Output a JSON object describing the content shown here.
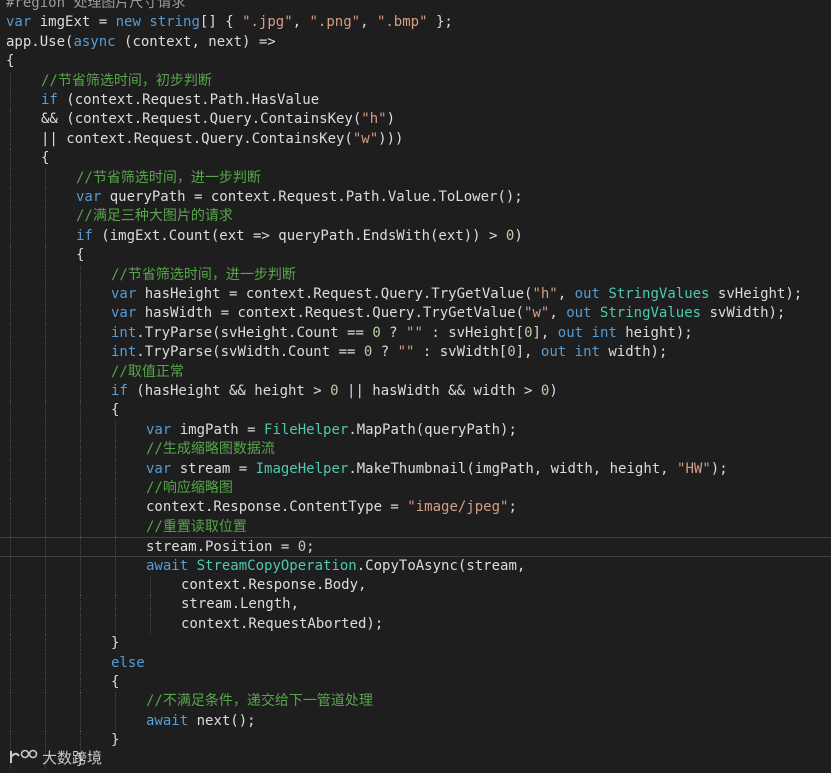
{
  "colors": {
    "background": "#1e1e1e",
    "text": "#dcdcdc",
    "keyword": "#569cd6",
    "comment": "#57a64a",
    "string": "#d69d85",
    "type": "#4ec9b0",
    "number": "#b5cea8",
    "region": "#9b9b9b"
  },
  "watermark": {
    "text": "大数跨境",
    "icon": "logo-icon"
  },
  "current_line": 28,
  "lines": [
    {
      "indent": 0,
      "tokens": [
        [
          "#region ",
          "region"
        ],
        [
          "处理图片尺寸请求",
          "region"
        ]
      ]
    },
    {
      "indent": 0,
      "tokens": [
        [
          "var",
          "keyword"
        ],
        [
          " imgExt = ",
          "text"
        ],
        [
          "new",
          "keyword"
        ],
        [
          " ",
          "text"
        ],
        [
          "string",
          "keyword"
        ],
        [
          "[] { ",
          "text"
        ],
        [
          "\".jpg\"",
          "string"
        ],
        [
          ", ",
          "text"
        ],
        [
          "\".png\"",
          "string"
        ],
        [
          ", ",
          "text"
        ],
        [
          "\".bmp\"",
          "string"
        ],
        [
          " };",
          "text"
        ]
      ]
    },
    {
      "indent": 0,
      "tokens": [
        [
          "app.Use(",
          "text"
        ],
        [
          "async",
          "keyword"
        ],
        [
          " (context, next) =>",
          "text"
        ]
      ]
    },
    {
      "indent": 0,
      "tokens": [
        [
          "{",
          "text"
        ]
      ]
    },
    {
      "indent": 1,
      "tokens": [
        [
          "//节省筛选时间，初步判断",
          "comment"
        ]
      ]
    },
    {
      "indent": 1,
      "tokens": [
        [
          "if",
          "keyword"
        ],
        [
          " (context.Request.Path.HasValue",
          "text"
        ]
      ]
    },
    {
      "indent": 1,
      "tokens": [
        [
          "&& (context.Request.Query.ContainsKey(",
          "text"
        ],
        [
          "\"h\"",
          "string"
        ],
        [
          ")",
          "text"
        ]
      ]
    },
    {
      "indent": 1,
      "tokens": [
        [
          "|| context.Request.Query.ContainsKey(",
          "text"
        ],
        [
          "\"w\"",
          "string"
        ],
        [
          ")))",
          "text"
        ]
      ]
    },
    {
      "indent": 1,
      "tokens": [
        [
          "{",
          "text"
        ]
      ]
    },
    {
      "indent": 2,
      "tokens": [
        [
          "//节省筛选时间，进一步判断",
          "comment"
        ]
      ]
    },
    {
      "indent": 2,
      "tokens": [
        [
          "var",
          "keyword"
        ],
        [
          " queryPath = context.Request.Path.Value.ToLower();",
          "text"
        ]
      ]
    },
    {
      "indent": 2,
      "tokens": [
        [
          "//满足三种大图片的请求",
          "comment"
        ]
      ]
    },
    {
      "indent": 2,
      "tokens": [
        [
          "if",
          "keyword"
        ],
        [
          " (imgExt.Count(ext => queryPath.EndsWith(ext)) > ",
          "text"
        ],
        [
          "0",
          "number"
        ],
        [
          ")",
          "text"
        ]
      ]
    },
    {
      "indent": 2,
      "tokens": [
        [
          "{",
          "text"
        ]
      ]
    },
    {
      "indent": 3,
      "tokens": [
        [
          "//节省筛选时间，进一步判断",
          "comment"
        ]
      ]
    },
    {
      "indent": 3,
      "tokens": [
        [
          "var",
          "keyword"
        ],
        [
          " hasHeight = context.Request.Query.TryGetValue(",
          "text"
        ],
        [
          "\"h\"",
          "string"
        ],
        [
          ", ",
          "text"
        ],
        [
          "out",
          "keyword"
        ],
        [
          " ",
          "text"
        ],
        [
          "StringValues",
          "type"
        ],
        [
          " svHeight);",
          "text"
        ]
      ]
    },
    {
      "indent": 3,
      "tokens": [
        [
          "var",
          "keyword"
        ],
        [
          " hasWidth = context.Request.Query.TryGetValue(",
          "text"
        ],
        [
          "\"w\"",
          "string"
        ],
        [
          ", ",
          "text"
        ],
        [
          "out",
          "keyword"
        ],
        [
          " ",
          "text"
        ],
        [
          "StringValues",
          "type"
        ],
        [
          " svWidth);",
          "text"
        ]
      ]
    },
    {
      "indent": 3,
      "tokens": [
        [
          "int",
          "keyword"
        ],
        [
          ".TryParse(svHeight.Count == ",
          "text"
        ],
        [
          "0",
          "number"
        ],
        [
          " ? ",
          "text"
        ],
        [
          "\"\"",
          "string"
        ],
        [
          " : svHeight[",
          "text"
        ],
        [
          "0",
          "number"
        ],
        [
          "], ",
          "text"
        ],
        [
          "out",
          "keyword"
        ],
        [
          " ",
          "text"
        ],
        [
          "int",
          "keyword"
        ],
        [
          " height);",
          "text"
        ]
      ]
    },
    {
      "indent": 3,
      "tokens": [
        [
          "int",
          "keyword"
        ],
        [
          ".TryParse(svWidth.Count == ",
          "text"
        ],
        [
          "0",
          "number"
        ],
        [
          " ? ",
          "text"
        ],
        [
          "\"\"",
          "string"
        ],
        [
          " : svWidth[",
          "text"
        ],
        [
          "0",
          "number"
        ],
        [
          "], ",
          "text"
        ],
        [
          "out",
          "keyword"
        ],
        [
          " ",
          "text"
        ],
        [
          "int",
          "keyword"
        ],
        [
          " width);",
          "text"
        ]
      ]
    },
    {
      "indent": 3,
      "tokens": [
        [
          "//取值正常",
          "comment"
        ]
      ]
    },
    {
      "indent": 3,
      "tokens": [
        [
          "if",
          "keyword"
        ],
        [
          " (hasHeight && height > ",
          "text"
        ],
        [
          "0",
          "number"
        ],
        [
          " || hasWidth && width > ",
          "text"
        ],
        [
          "0",
          "number"
        ],
        [
          ")",
          "text"
        ]
      ]
    },
    {
      "indent": 3,
      "tokens": [
        [
          "{",
          "text"
        ]
      ]
    },
    {
      "indent": 4,
      "tokens": [
        [
          "var",
          "keyword"
        ],
        [
          " imgPath = ",
          "text"
        ],
        [
          "FileHelper",
          "type"
        ],
        [
          ".MapPath(queryPath);",
          "text"
        ]
      ]
    },
    {
      "indent": 4,
      "tokens": [
        [
          "//生成缩略图数据流",
          "comment"
        ]
      ]
    },
    {
      "indent": 4,
      "tokens": [
        [
          "var",
          "keyword"
        ],
        [
          " stream = ",
          "text"
        ],
        [
          "ImageHelper",
          "type"
        ],
        [
          ".MakeThumbnail(imgPath, width, height, ",
          "text"
        ],
        [
          "\"HW\"",
          "string"
        ],
        [
          ");",
          "text"
        ]
      ]
    },
    {
      "indent": 4,
      "tokens": [
        [
          "//响应缩略图",
          "comment"
        ]
      ]
    },
    {
      "indent": 4,
      "tokens": [
        [
          "context.Response.ContentType = ",
          "text"
        ],
        [
          "\"image/jpeg\"",
          "string"
        ],
        [
          ";",
          "text"
        ]
      ]
    },
    {
      "indent": 4,
      "tokens": [
        [
          "//重置读取位置",
          "comment"
        ]
      ]
    },
    {
      "indent": 4,
      "tokens": [
        [
          "stream.Position = ",
          "text"
        ],
        [
          "0",
          "number"
        ],
        [
          ";",
          "text"
        ]
      ]
    },
    {
      "indent": 4,
      "tokens": [
        [
          "await",
          "keyword"
        ],
        [
          " ",
          "text"
        ],
        [
          "StreamCopyOperation",
          "type"
        ],
        [
          ".CopyToAsync(stream,",
          "text"
        ]
      ]
    },
    {
      "indent": 5,
      "tokens": [
        [
          "context.Response.Body,",
          "text"
        ]
      ]
    },
    {
      "indent": 5,
      "tokens": [
        [
          "stream.Length,",
          "text"
        ]
      ]
    },
    {
      "indent": 5,
      "tokens": [
        [
          "context.RequestAborted);",
          "text"
        ]
      ]
    },
    {
      "indent": 3,
      "tokens": [
        [
          "}",
          "text"
        ]
      ]
    },
    {
      "indent": 3,
      "tokens": [
        [
          "else",
          "keyword"
        ]
      ]
    },
    {
      "indent": 3,
      "tokens": [
        [
          "{",
          "text"
        ]
      ]
    },
    {
      "indent": 4,
      "tokens": [
        [
          "//不满足条件，递交给下一管道处理",
          "comment"
        ]
      ]
    },
    {
      "indent": 4,
      "tokens": [
        [
          "await",
          "keyword"
        ],
        [
          " next();",
          "text"
        ]
      ]
    },
    {
      "indent": 3,
      "tokens": [
        [
          "}",
          "text"
        ]
      ]
    },
    {
      "indent": 2,
      "tokens": [
        [
          "}",
          "text"
        ]
      ]
    }
  ]
}
